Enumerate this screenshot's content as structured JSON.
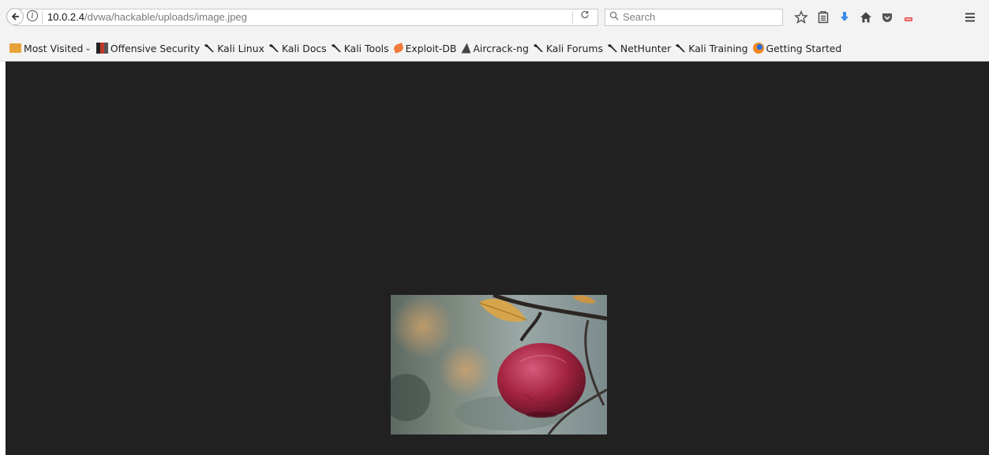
{
  "browser": {
    "url": {
      "host": "10.0.2.4",
      "path": "/dvwa/hackable/uploads/image.jpeg"
    },
    "search_placeholder": "Search",
    "toolbar_icons": [
      "back-arrow-icon",
      "info-icon",
      "reload-icon",
      "search-icon",
      "star-icon",
      "reading-list-icon",
      "download-icon",
      "home-icon",
      "pocket-icon",
      "extension-icon",
      "menu-icon"
    ],
    "accent_download": "#3f8be8"
  },
  "bookmarks": {
    "most_visited": "Most Visited",
    "items": [
      {
        "label": "Offensive Security",
        "icon": "offensive-security-icon"
      },
      {
        "label": "Kali Linux",
        "icon": "kali-dragon-icon"
      },
      {
        "label": "Kali Docs",
        "icon": "kali-dragon-icon"
      },
      {
        "label": "Kali Tools",
        "icon": "kali-dragon-icon"
      },
      {
        "label": "Exploit-DB",
        "icon": "exploit-db-icon"
      },
      {
        "label": "Aircrack-ng",
        "icon": "aircrack-icon"
      },
      {
        "label": "Kali Forums",
        "icon": "kali-dragon-icon"
      },
      {
        "label": "NetHunter",
        "icon": "kali-dragon-icon"
      },
      {
        "label": "Kali Training",
        "icon": "kali-dragon-icon"
      },
      {
        "label": "Getting Started",
        "icon": "firefox-icon"
      }
    ]
  },
  "page": {
    "background": "#212121",
    "image_subject": "red apple on branch"
  }
}
